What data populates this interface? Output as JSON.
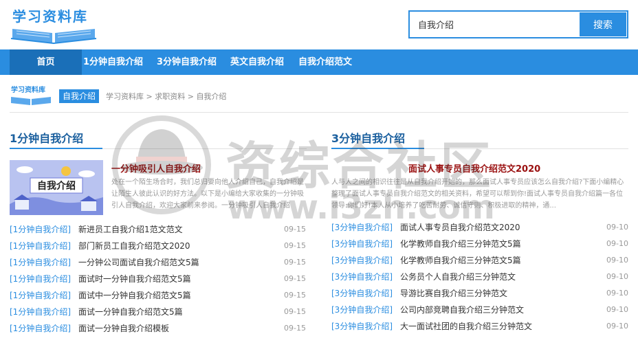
{
  "site": {
    "logo_text": "学习资料库",
    "crumb_logo_text": "学习资料库"
  },
  "search": {
    "value": "自我介绍",
    "button_label": "搜索"
  },
  "nav": {
    "items": [
      {
        "label": "首页"
      },
      {
        "label": "1分钟自我介绍"
      },
      {
        "label": "3分钟自我介绍"
      },
      {
        "label": "英文自我介绍"
      },
      {
        "label": "自我介绍范文"
      }
    ]
  },
  "breadcrumb": {
    "tag": "自我介绍",
    "parts": [
      "学习资料库",
      ">",
      "求职资料",
      ">",
      "自我介绍"
    ]
  },
  "left": {
    "title": "1分钟自我介绍",
    "feature": {
      "image_text": "自我介绍",
      "title": "一分钟吸引人自我介绍",
      "desc": "处在一个陌生场合时，我们总归要向他人介绍自己，自我介绍是让陌生人彼此认识的好方法。以下是小编给大家收集的一分钟吸引人自我介绍，欢迎大家前来参阅。一分钟吸引人自我介绍"
    },
    "items": [
      {
        "cat": "[1分钟自我介绍]",
        "title": "新进员工自我介绍1范文范文",
        "date": "09-15"
      },
      {
        "cat": "[1分钟自我介绍]",
        "title": "部门新员工自我介绍范文2020",
        "date": "09-15"
      },
      {
        "cat": "[1分钟自我介绍]",
        "title": "一分钟公司面试自我介绍范文5篇",
        "date": "09-15"
      },
      {
        "cat": "[1分钟自我介绍]",
        "title": "面试时一分钟自我介绍范文5篇",
        "date": "09-15"
      },
      {
        "cat": "[1分钟自我介绍]",
        "title": "面试中一分钟自我介绍范文5篇",
        "date": "09-15"
      },
      {
        "cat": "[1分钟自我介绍]",
        "title": "面试一分钟自我介绍范文5篇",
        "date": "09-15"
      },
      {
        "cat": "[1分钟自我介绍]",
        "title": "面试一分钟自我介绍模板",
        "date": "09-15"
      }
    ]
  },
  "right": {
    "title": "3分钟自我介绍",
    "feature": {
      "title": "面试人事专员自我介绍范文2020",
      "desc": "人与人之间的相识往往是从自我介绍开始的，那么面试人事专员应该怎么自我介绍?下面小编精心整理了面试人事专员自我介绍范文的相关资料，希望可以帮到你!面试人事专员自我介绍篇一各位领导:你们好!本人从小培养了吃苦耐劳、诚信守则、积极进取的精神，通..."
    },
    "items": [
      {
        "cat": "[3分钟自我介绍]",
        "title": "面试人事专员自我介绍范文2020",
        "date": "09-10"
      },
      {
        "cat": "[3分钟自我介绍]",
        "title": "化学教师自我介绍三分钟范文5篇",
        "date": "09-10"
      },
      {
        "cat": "[3分钟自我介绍]",
        "title": "化学教师自我介绍三分钟范文5篇",
        "date": "09-10"
      },
      {
        "cat": "[3分钟自我介绍]",
        "title": "公务员个人自我介绍三分钟范文",
        "date": "09-10"
      },
      {
        "cat": "[3分钟自我介绍]",
        "title": "导游比赛自我介绍三分钟范文",
        "date": "09-10"
      },
      {
        "cat": "[3分钟自我介绍]",
        "title": "公司内部竞聘自我介绍三分钟范文",
        "date": "09-10"
      },
      {
        "cat": "[3分钟自我介绍]",
        "title": "大一面试社团的自我介绍三分钟范文",
        "date": "09-10"
      }
    ]
  },
  "watermark": {
    "text": "资综合社区",
    "url": "www.i3zh.com"
  },
  "colors": {
    "brand": "#2a8de0",
    "nav_active": "#1a6fb8",
    "feature_title": "#9a1010"
  }
}
